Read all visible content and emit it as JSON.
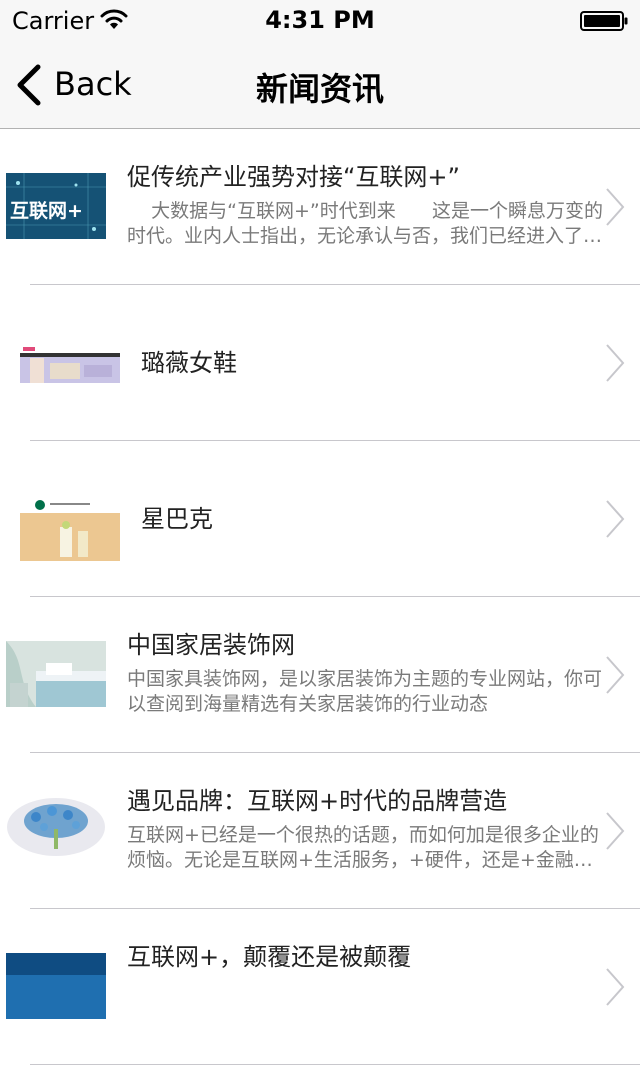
{
  "status_bar": {
    "carrier": "Carrier",
    "time": "4:31 PM",
    "wifi_icon": "wifi-icon",
    "battery_icon": "battery-icon"
  },
  "nav": {
    "back_label": "Back",
    "back_icon": "chevron-left-icon",
    "title": "新闻资讯"
  },
  "news": [
    {
      "title": "促传统产业强势对接“互联网+”",
      "description": "    大数据与“互联网+”时代到来      这是一个瞬息万变的时代。业内人士指出，无论承认与否，我们已经进入了一个新的时代",
      "thumb_text": "互联网+"
    },
    {
      "title": "璐薇女鞋",
      "description": ""
    },
    {
      "title": "星巴克",
      "description": ""
    },
    {
      "title": "中国家居装饰网",
      "description": "中国家具装饰网，是以家居装饰为主题的专业网站，你可以查阅到海量精选有关家居装饰的行业动态"
    },
    {
      "title": "遇见品牌：互联网+时代的品牌营造",
      "description": "互联网+已经是一个很热的话题，而如何加是很多企业的烦恼。无论是互联网+生活服务，+硬件，还是+金融都需要思考"
    },
    {
      "title": "互联网+，颠覆还是被颠覆",
      "description": ""
    }
  ],
  "colors": {
    "bar_background": "#f7f7f7",
    "separator": "#c8c7cc",
    "chevron": "#c7c7cc",
    "description_text": "#7a7a7a"
  }
}
